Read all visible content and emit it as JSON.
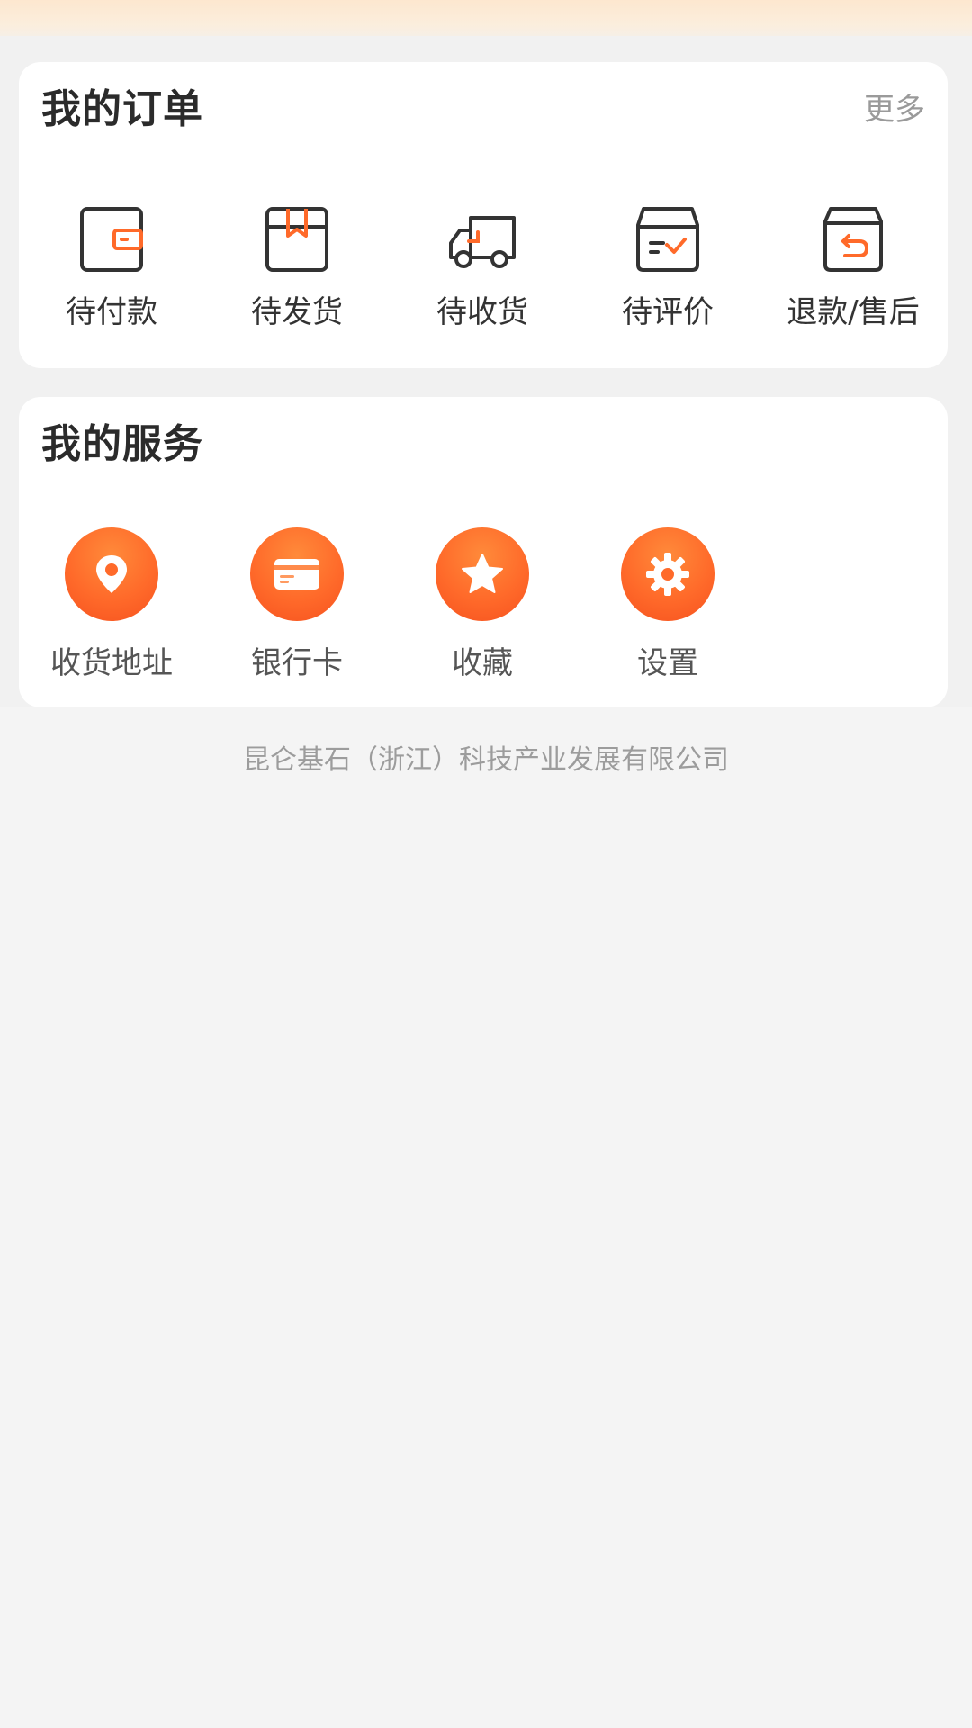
{
  "orders": {
    "title": "我的订单",
    "more_label": "更多",
    "items": [
      {
        "label": "待付款",
        "icon": "wallet-icon"
      },
      {
        "label": "待发货",
        "icon": "package-icon"
      },
      {
        "label": "待收货",
        "icon": "truck-icon"
      },
      {
        "label": "待评价",
        "icon": "review-box-icon"
      },
      {
        "label": "退款/售后",
        "icon": "return-box-icon"
      }
    ]
  },
  "services": {
    "title": "我的服务",
    "items": [
      {
        "label": "收货地址",
        "icon": "location-pin-icon"
      },
      {
        "label": "银行卡",
        "icon": "bank-card-icon"
      },
      {
        "label": "收藏",
        "icon": "star-icon"
      },
      {
        "label": "设置",
        "icon": "gear-icon"
      }
    ]
  },
  "footer": {
    "company": "昆仑基石（浙江）科技产业发展有限公司"
  },
  "colors": {
    "accent": "#ff6a2a",
    "icon_stroke": "#333333",
    "page_background": "#f4f4f4",
    "card_background": "#ffffff"
  }
}
